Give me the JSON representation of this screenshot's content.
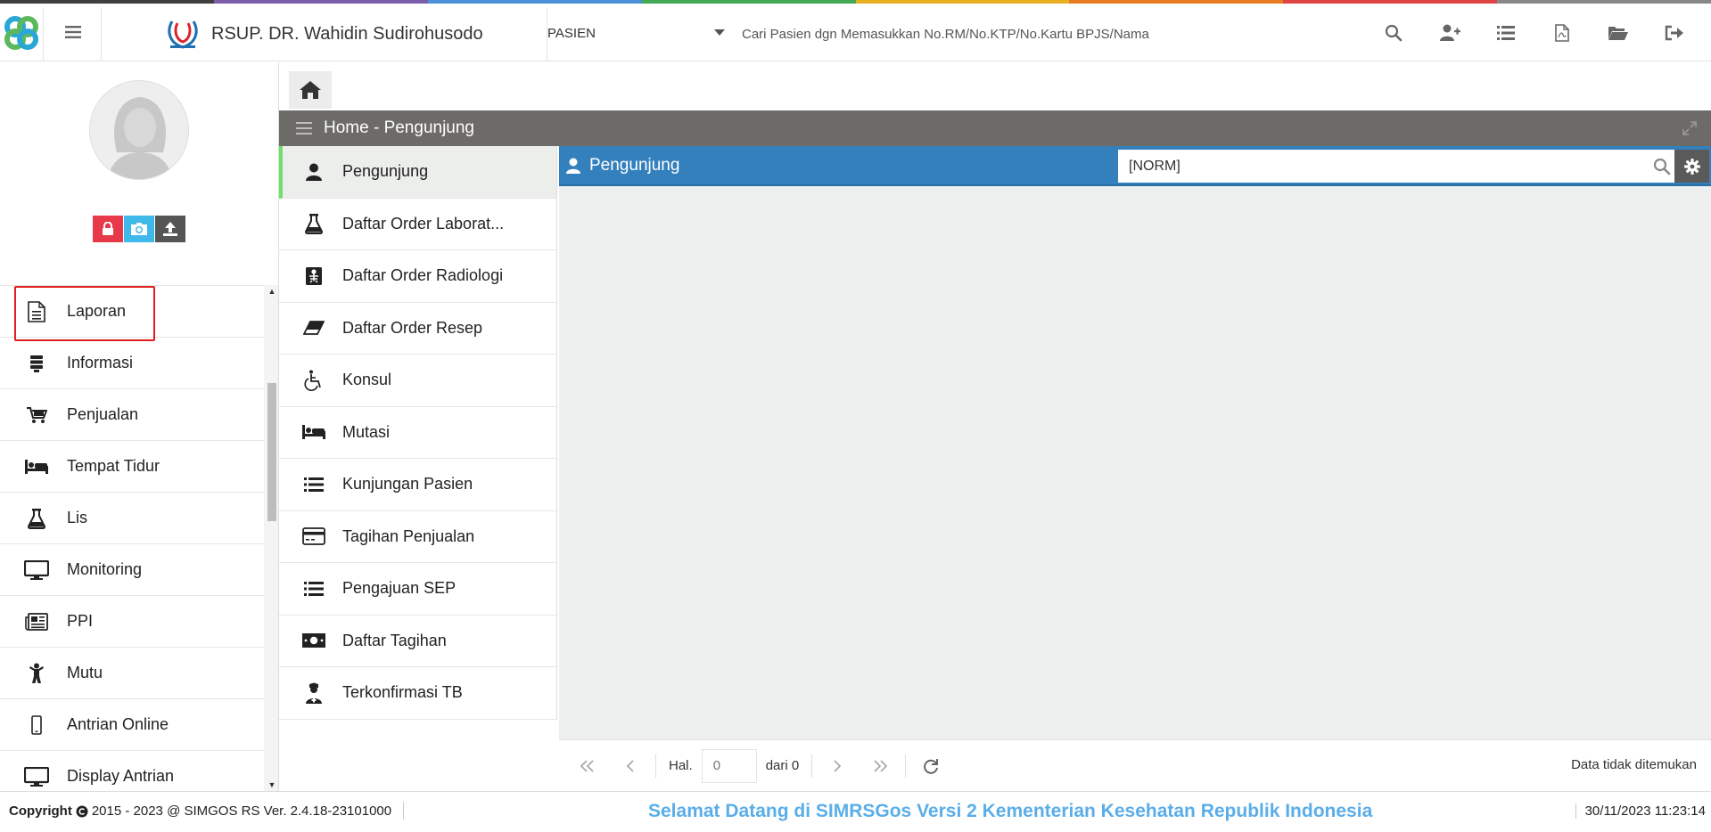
{
  "header": {
    "hospital_name": "RSUP. DR. Wahidin Sudirohusodo",
    "module_selected": "PASIEN",
    "search_placeholder": "Cari Pasien dgn Memasukkan No.RM/No.KTP/No.Kartu BPJS/Nama",
    "stripe_colors": [
      "#3f3f3f",
      "#7b5ea7",
      "#4a90d9",
      "#44aa55",
      "#e8b020",
      "#e87a20",
      "#dd4444",
      "#888888"
    ],
    "icons": [
      "search-icon",
      "add-user-icon",
      "list-icon",
      "pdf-icon",
      "folder-open-icon",
      "sign-out-icon"
    ]
  },
  "sidebar": {
    "avatar_buttons": [
      {
        "name": "lock",
        "color": "#e8394a"
      },
      {
        "name": "camera",
        "color": "#3fb8ea"
      },
      {
        "name": "upload",
        "color": "#555555"
      }
    ],
    "items": [
      {
        "label": "Laporan",
        "icon": "file-text-icon"
      },
      {
        "label": "Informasi",
        "icon": "database-icon"
      },
      {
        "label": "Penjualan",
        "icon": "cart-icon"
      },
      {
        "label": "Tempat Tidur",
        "icon": "bed-icon"
      },
      {
        "label": "Lis",
        "icon": "flask-icon"
      },
      {
        "label": "Monitoring",
        "icon": "monitor-icon"
      },
      {
        "label": "PPI",
        "icon": "newspaper-icon"
      },
      {
        "label": "Mutu",
        "icon": "child-icon"
      },
      {
        "label": "Antrian Online",
        "icon": "mobile-icon"
      },
      {
        "label": "Display Antrian",
        "icon": "monitor-icon"
      }
    ]
  },
  "main": {
    "panel_title": "Home - Pengunjung",
    "submenu": [
      {
        "label": "Pengunjung",
        "icon": "user-icon",
        "active": true
      },
      {
        "label": "Daftar Order Laborat...",
        "icon": "flask-icon"
      },
      {
        "label": "Daftar Order Radiologi",
        "icon": "xray-icon"
      },
      {
        "label": "Daftar Order Resep",
        "icon": "eraser-icon"
      },
      {
        "label": "Konsul",
        "icon": "wheelchair-icon"
      },
      {
        "label": "Mutasi",
        "icon": "bed-icon"
      },
      {
        "label": "Kunjungan Pasien",
        "icon": "list-icon"
      },
      {
        "label": "Tagihan Penjualan",
        "icon": "credit-card-icon"
      },
      {
        "label": "Pengajuan SEP",
        "icon": "list-icon"
      },
      {
        "label": "Daftar Tagihan",
        "icon": "money-icon"
      },
      {
        "label": "Terkonfirmasi TB",
        "icon": "user-nurse-icon"
      }
    ],
    "grid": {
      "title": "Pengunjung",
      "search_value": "[NORM]",
      "pager_hal": "Hal.",
      "pager_page_value": "0",
      "pager_dari": "dari 0",
      "status": "Data tidak ditemukan"
    }
  },
  "footer": {
    "copyright": "Copyright",
    "copyright_rest": "2015 - 2023 @ SIMGOS RS Ver. 2.4.18-23101000",
    "marquee": "Selamat Datang di SIMRSGos Versi 2 Kementerian Kesehatan Republik Indonesia",
    "datetime": "30/11/2023 11:23:14"
  }
}
